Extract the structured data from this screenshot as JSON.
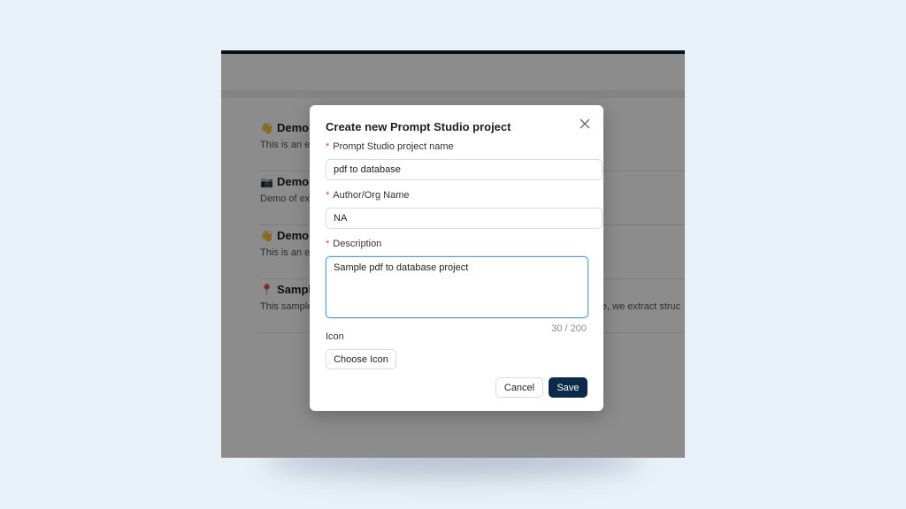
{
  "background_list": {
    "items": [
      {
        "emoji": "👋",
        "title": "Demo I",
        "desc": "This is an ext",
        "desc_right": ""
      },
      {
        "emoji": "📷",
        "title": "Demo S",
        "desc": "Demo of ext",
        "desc_right": ""
      },
      {
        "emoji": "👋",
        "title": "Demo I",
        "desc": "This is an ext",
        "desc_right": ""
      },
      {
        "emoji": "📍",
        "title": "Sample",
        "desc": "This sample",
        "desc_right": "here, we extract struc"
      }
    ]
  },
  "modal": {
    "title": "Create new Prompt Studio project",
    "project_name": {
      "label": "Prompt Studio project name",
      "value": "pdf to database"
    },
    "author": {
      "label": "Author/Org Name",
      "value": "NA"
    },
    "description": {
      "label": "Description",
      "value": "Sample pdf to database project",
      "count": "30 / 200"
    },
    "icon": {
      "label": "Icon",
      "button": "Choose Icon"
    },
    "cancel_label": "Cancel",
    "save_label": "Save"
  },
  "colors": {
    "primary": "#0b2a4a",
    "focus": "#5b9bd5",
    "required": "#e5484d",
    "topbar": "#0b1e33"
  }
}
